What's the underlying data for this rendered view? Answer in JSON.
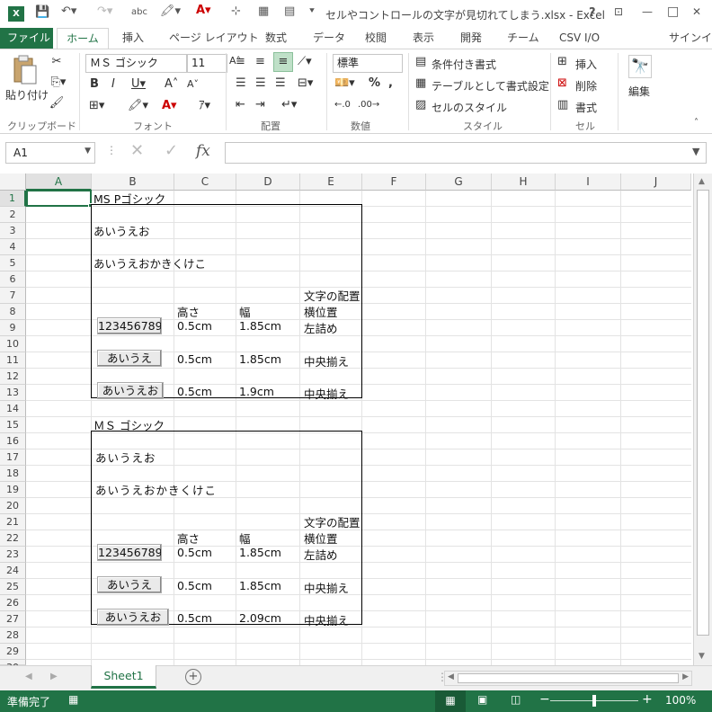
{
  "window": {
    "title": "セルやコントロールの文字が見切れてしまう.xlsx - Excel",
    "help": "?",
    "minimize": "—",
    "restore": "□",
    "close": "✕"
  },
  "tabs": [
    "ファイル",
    "ホーム",
    "挿入",
    "ページ レイアウト",
    "数式",
    "データ",
    "校閲",
    "表示",
    "開発",
    "チーム",
    "CSV I/O"
  ],
  "signin": "サインイン",
  "ribbon": {
    "paste": "貼り付け",
    "clipboard": "クリップボード",
    "font_name": "ＭＳ ゴシック",
    "font_size": "11",
    "font": "フォント",
    "alignment": "配置",
    "number_format": "標準",
    "number": "数値",
    "cond_format": "条件付き書式",
    "table_format": "テーブルとして書式設定",
    "cell_style": "セルのスタイル",
    "style": "スタイル",
    "insert": "挿入",
    "delete": "削除",
    "format": "書式",
    "cells": "セル",
    "edit": "編集"
  },
  "formula_bar": {
    "name_box": "A1",
    "fx": "fx",
    "value": ""
  },
  "columns": [
    "A",
    "B",
    "C",
    "D",
    "E",
    "F",
    "G",
    "H",
    "I",
    "J"
  ],
  "rows": [
    "1",
    "2",
    "3",
    "4",
    "5",
    "6",
    "7",
    "8",
    "9",
    "10",
    "11",
    "12",
    "13",
    "14",
    "15",
    "16",
    "17",
    "18",
    "19",
    "20",
    "21",
    "22",
    "23",
    "24",
    "25",
    "26",
    "27",
    "28",
    "29",
    "30"
  ],
  "sheet": {
    "b1": "MS Pゴシック",
    "b3": "あいうえお",
    "b5": "あいうえおかきくけこ",
    "e7": "文字の配置",
    "c8": "高さ",
    "d8": "幅",
    "e8": "横位置",
    "btn9": "123456789",
    "c9": "0.5cm",
    "d9": "1.85cm",
    "e9": "左詰め",
    "btn11": "あいうえ",
    "c11": "0.5cm",
    "d11": "1.85cm",
    "e11": "中央揃え",
    "btn13": "あいうえお",
    "c13": "0.5cm",
    "d13": "1.9cm",
    "e13": "中央揃え",
    "b15": "ＭＳ ゴシック",
    "b17": "あいうえお",
    "b19": "あいうえおかきくけこ",
    "e21": "文字の配置",
    "c22": "高さ",
    "d22": "幅",
    "e22": "横位置",
    "btn23": "123456789",
    "c23": "0.5cm",
    "d23": "1.85cm",
    "e23": "左詰め",
    "btn25": "あいうえ",
    "c25": "0.5cm",
    "d25": "1.85cm",
    "e25": "中央揃え",
    "btn27": "あいうえお",
    "c27": "0.5cm",
    "d27": "2.09cm",
    "e27": "中央揃え"
  },
  "sheet_tab": "Sheet1",
  "status": {
    "ready": "準備完了",
    "zoom": "100%"
  },
  "colors": {
    "accent": "#217346"
  }
}
